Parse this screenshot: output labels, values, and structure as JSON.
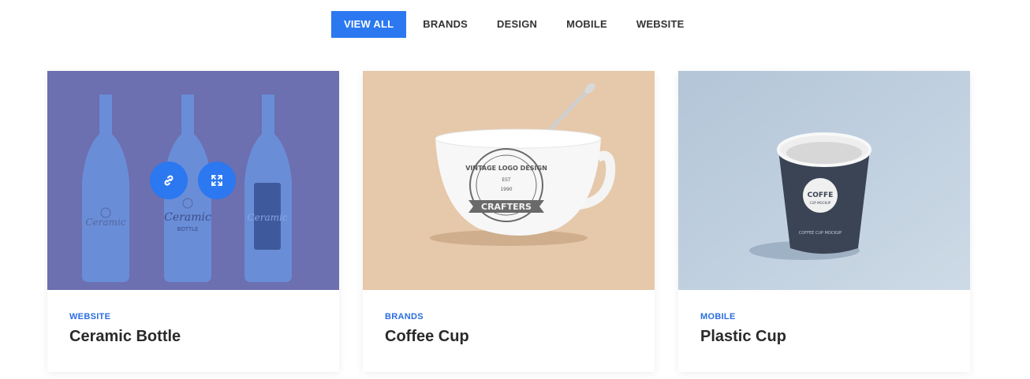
{
  "filters": [
    {
      "label": "VIEW ALL",
      "active": true
    },
    {
      "label": "BRANDS",
      "active": false
    },
    {
      "label": "DESIGN",
      "active": false
    },
    {
      "label": "MOBILE",
      "active": false
    },
    {
      "label": "WEBSITE",
      "active": false
    }
  ],
  "cards": [
    {
      "category": "WEBSITE",
      "title": "Ceramic Bottle",
      "bottle_text": "Ceramic",
      "bottle_sub": "BOTTLE"
    },
    {
      "category": "BRANDS",
      "title": "Coffee Cup",
      "cup_ribbon": "CRAFTERS",
      "cup_arc": "VINTAGE LOGO DESIGN",
      "cup_est": "EST",
      "cup_year": "1990"
    },
    {
      "category": "MOBILE",
      "title": "Plastic Cup",
      "cup_badge": "COFFE",
      "cup_badge_sub": "CUP MOCKUP",
      "cup_caption": "COFFEE CUP MOCKUP"
    }
  ],
  "colors": {
    "accent": "#2b78f0",
    "category": "#2b6de0"
  },
  "icons": {
    "link": "link-icon",
    "expand": "expand-icon"
  }
}
